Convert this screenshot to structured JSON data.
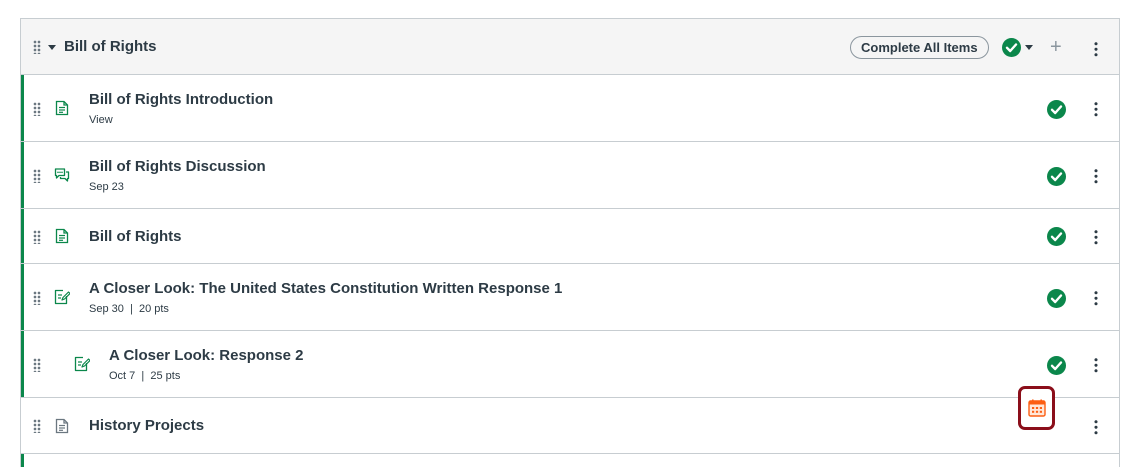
{
  "module": {
    "title": "Bill of Rights",
    "complete_all_label": "Complete All Items"
  },
  "items": [
    {
      "title": "Bill of Rights Introduction",
      "meta": "View",
      "icon": "page-icon",
      "completed": true
    },
    {
      "title": "Bill of Rights Discussion",
      "meta": "Sep 23",
      "icon": "discussion-icon",
      "completed": true
    },
    {
      "title": "Bill of Rights",
      "meta": "",
      "icon": "page-icon",
      "completed": true
    },
    {
      "title": "A Closer Look: The United States Constitution Written Response 1",
      "meta": "Sep 30  |  20 pts",
      "icon": "assignment-icon",
      "completed": true
    },
    {
      "title": "A Closer Look: Response 2",
      "meta": "Oct 7  |  25 pts",
      "icon": "assignment-icon",
      "completed": true
    },
    {
      "title": "History Projects",
      "meta": "",
      "icon": "page-icon",
      "completed": false,
      "status_icon": "calendar-icon"
    }
  ],
  "colors": {
    "complete_green": "#0b874b",
    "calendar_orange": "#fc5e13",
    "highlight_red": "#8b0e1a"
  }
}
